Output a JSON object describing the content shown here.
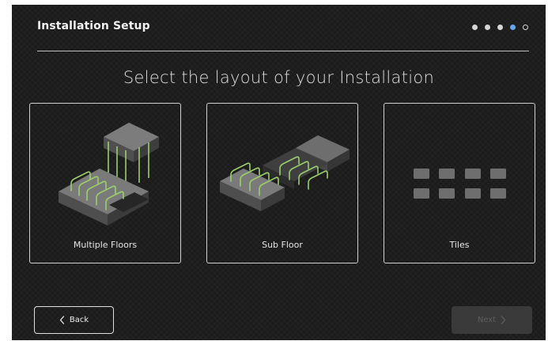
{
  "header": {
    "title": "Installation Setup",
    "steps": [
      "complete",
      "complete",
      "complete",
      "current",
      "pending"
    ]
  },
  "main": {
    "heading": "Select the layout of your Installation",
    "options": [
      {
        "label": "Multiple Floors",
        "icon": "multiple-floors-illustration"
      },
      {
        "label": "Sub Floor",
        "icon": "sub-floor-illustration"
      },
      {
        "label": "Tiles",
        "icon": "tiles-illustration"
      }
    ]
  },
  "footer": {
    "back_label": "Back",
    "next_label": "Next",
    "next_enabled": false
  },
  "colors": {
    "background": "#1b1b1b",
    "accent_step": "#64a6f0",
    "cable_green": "#9bcf6c",
    "disabled_button": "#3a3a3a"
  }
}
